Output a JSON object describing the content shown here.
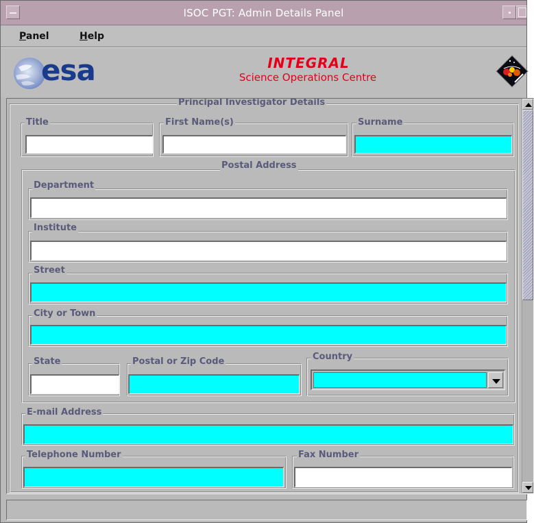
{
  "window": {
    "title": "ISOC PGT: Admin Details Panel"
  },
  "menu": {
    "items": [
      {
        "label_first": "P",
        "label_rest": "anel"
      },
      {
        "label_first": "H",
        "label_rest": "elp"
      }
    ]
  },
  "banner": {
    "esa_text": "esa",
    "integral_title": "INTEGRAL",
    "integral_subtitle": "Science Operations Centre"
  },
  "colors": {
    "mandatory_field": "#00ffff",
    "optional_field": "#ffffff",
    "banner_red": "#e4001b",
    "esa_blue": "#1a3a8c",
    "group_label": "#5a5a7a"
  },
  "pi_details": {
    "legend": "Principal Investigator Details",
    "title_label": "Title",
    "title_value": "",
    "first_name_label": "First Name(s)",
    "first_name_value": "",
    "surname_label": "Surname",
    "surname_value": "",
    "postal": {
      "legend": "Postal Address",
      "department_label": "Department",
      "department_value": "",
      "institute_label": "Institute",
      "institute_value": "",
      "street_label": "Street",
      "street_value": "",
      "city_label": "City or Town",
      "city_value": "",
      "state_label": "State",
      "state_value": "",
      "zip_label": "Postal or Zip Code",
      "zip_value": "",
      "country_label": "Country",
      "country_value": ""
    },
    "email_label": "E-mail Address",
    "email_value": "",
    "phone_label": "Telephone Number",
    "phone_value": "",
    "fax_label": "Fax Number",
    "fax_value": ""
  },
  "icons": {
    "window_menu": "window-menu-icon",
    "minimize": "minimize-icon",
    "maximize": "maximize-icon",
    "scroll_up": "arrow-up-icon",
    "scroll_down": "arrow-down-icon",
    "dropdown": "chevron-down-icon"
  },
  "status": {
    "text": ""
  }
}
